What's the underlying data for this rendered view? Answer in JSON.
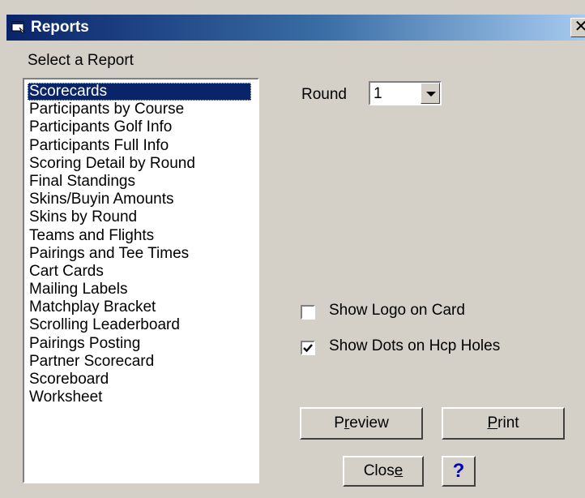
{
  "window": {
    "title": "Reports",
    "close_glyph": "✕"
  },
  "list": {
    "label": "Select a Report",
    "items": [
      "Scorecards",
      "Participants by Course",
      "Participants Golf Info",
      "Participants Full Info",
      "Scoring Detail by Round",
      "Final Standings",
      "Skins/Buyin Amounts",
      "Skins by Round",
      "Teams and Flights",
      "Pairings and Tee Times",
      "Cart Cards",
      "Mailing Labels",
      "Matchplay Bracket",
      "Scrolling Leaderboard",
      "Pairings Posting",
      "Partner Scorecard",
      "Scoreboard",
      "Worksheet"
    ],
    "selected": "Scorecards"
  },
  "round": {
    "label": "Round",
    "value": "1"
  },
  "options": {
    "show_logo": {
      "label": "Show Logo on Card",
      "checked": false
    },
    "show_dots": {
      "label": "Show Dots on Hcp Holes",
      "checked": true
    }
  },
  "buttons": {
    "preview": {
      "pre": "P",
      "key": "r",
      "post": "eview"
    },
    "print": {
      "pre": "",
      "key": "P",
      "post": "rint"
    },
    "close": {
      "pre": "Clos",
      "key": "e",
      "post": ""
    },
    "help": "?"
  },
  "colors": {
    "selection": "#0a246a",
    "face": "#d4d0c8",
    "title_start": "#0a246a",
    "title_end": "#a6caf0",
    "help": "#0000c0"
  }
}
